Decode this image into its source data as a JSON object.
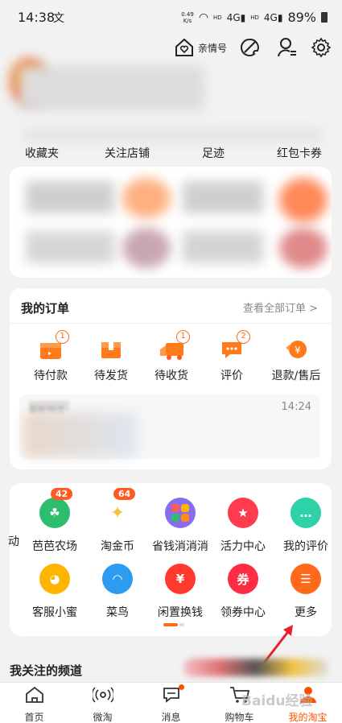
{
  "status": {
    "time": "14:38",
    "time_glyph": "文",
    "speed_value": "0.49",
    "speed_unit": "K/s",
    "net1": "HD",
    "net1b": "4G",
    "net2": "HD",
    "net2b": "4G",
    "battery": "89%"
  },
  "header": {
    "family_label": "亲情号"
  },
  "stats": [
    "收藏夹",
    "关注店铺",
    "足迹",
    "红包卡券"
  ],
  "orders": {
    "title": "我的订单",
    "view_all": "查看全部订单 >",
    "items": [
      {
        "label": "待付款",
        "badge": "1"
      },
      {
        "label": "待发货",
        "badge": ""
      },
      {
        "label": "待收货",
        "badge": "1"
      },
      {
        "label": "评价",
        "badge": "2"
      },
      {
        "label": "退款/售后",
        "badge": ""
      }
    ],
    "logistics_label": "最新物流",
    "logistics_time": "14:24"
  },
  "tools": {
    "partial_left": "动",
    "row1": [
      {
        "label": "芭芭农场",
        "badge": "42",
        "color": "#2dbd6e",
        "glyph": "☘"
      },
      {
        "label": "淘金币",
        "badge": "64",
        "color": "#ffffff",
        "glyph": "✦"
      },
      {
        "label": "省钱消消消",
        "badge": "",
        "color": "#8a6cf0",
        "glyph": "❖"
      },
      {
        "label": "活力中心",
        "badge": "",
        "color": "#ff3b4e",
        "glyph": "★"
      },
      {
        "label": "我的评价",
        "badge": "",
        "color": "#2ed1a8",
        "glyph": "…"
      }
    ],
    "row2": [
      {
        "label": "客服小蜜",
        "badge": "",
        "color": "#ffb400",
        "glyph": "◕"
      },
      {
        "label": "菜鸟",
        "badge": "",
        "color": "#2d9cf0",
        "glyph": "◠"
      },
      {
        "label": "闲置换钱",
        "badge": "",
        "color": "#ff3a2a",
        "glyph": "¥"
      },
      {
        "label": "领券中心",
        "badge": "",
        "color": "#ff2d44",
        "glyph": "券"
      },
      {
        "label": "更多",
        "badge": "",
        "color": "#ff6a1a",
        "glyph": "☰"
      }
    ]
  },
  "channels_title": "我关注的频道",
  "tabbar": [
    {
      "label": "首页",
      "icon": "home-icon"
    },
    {
      "label": "微淘",
      "icon": "broadcast-icon"
    },
    {
      "label": "消息",
      "icon": "message-icon"
    },
    {
      "label": "购物车",
      "icon": "cart-icon"
    },
    {
      "label": "我的淘宝",
      "icon": "profile-icon"
    }
  ],
  "watermark": "Baidu经验",
  "colors": {
    "accent": "#ff5000",
    "arrow": "#e8202a"
  }
}
